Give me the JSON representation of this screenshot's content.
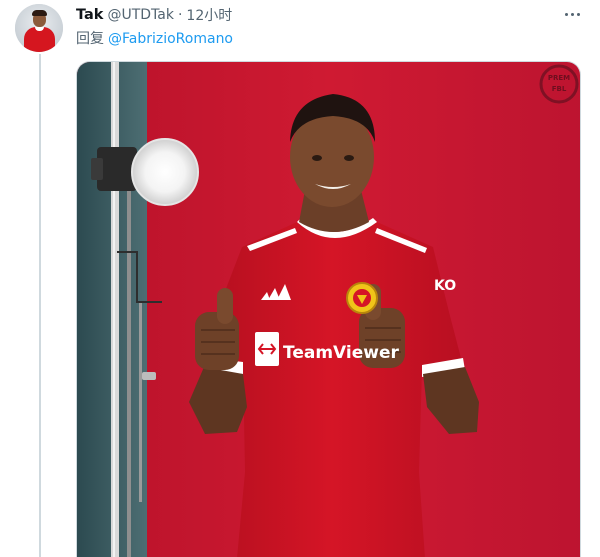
{
  "tweet": {
    "author_name": "Tak",
    "author_handle": "@UTDTak",
    "separator": "·",
    "timestamp": "12小时",
    "reply_prefix": "回复",
    "reply_mention": "@FabrizioRomano"
  },
  "media": {
    "shirt_sponsor": "TeamViewer",
    "sleeve_sponsor": "KO",
    "watermark_line1": "PREM",
    "watermark_line2": "FBL"
  },
  "colors": {
    "link_blue": "#1d9bf0",
    "muted_text": "#536471",
    "studio_red": "#c8152c",
    "kit_red": "#d31224"
  },
  "icons": {
    "more": "more-horizontal-icon",
    "adidas": "adidas-logo-icon",
    "crest": "club-crest-icon",
    "teamviewer": "teamviewer-logo-icon"
  }
}
